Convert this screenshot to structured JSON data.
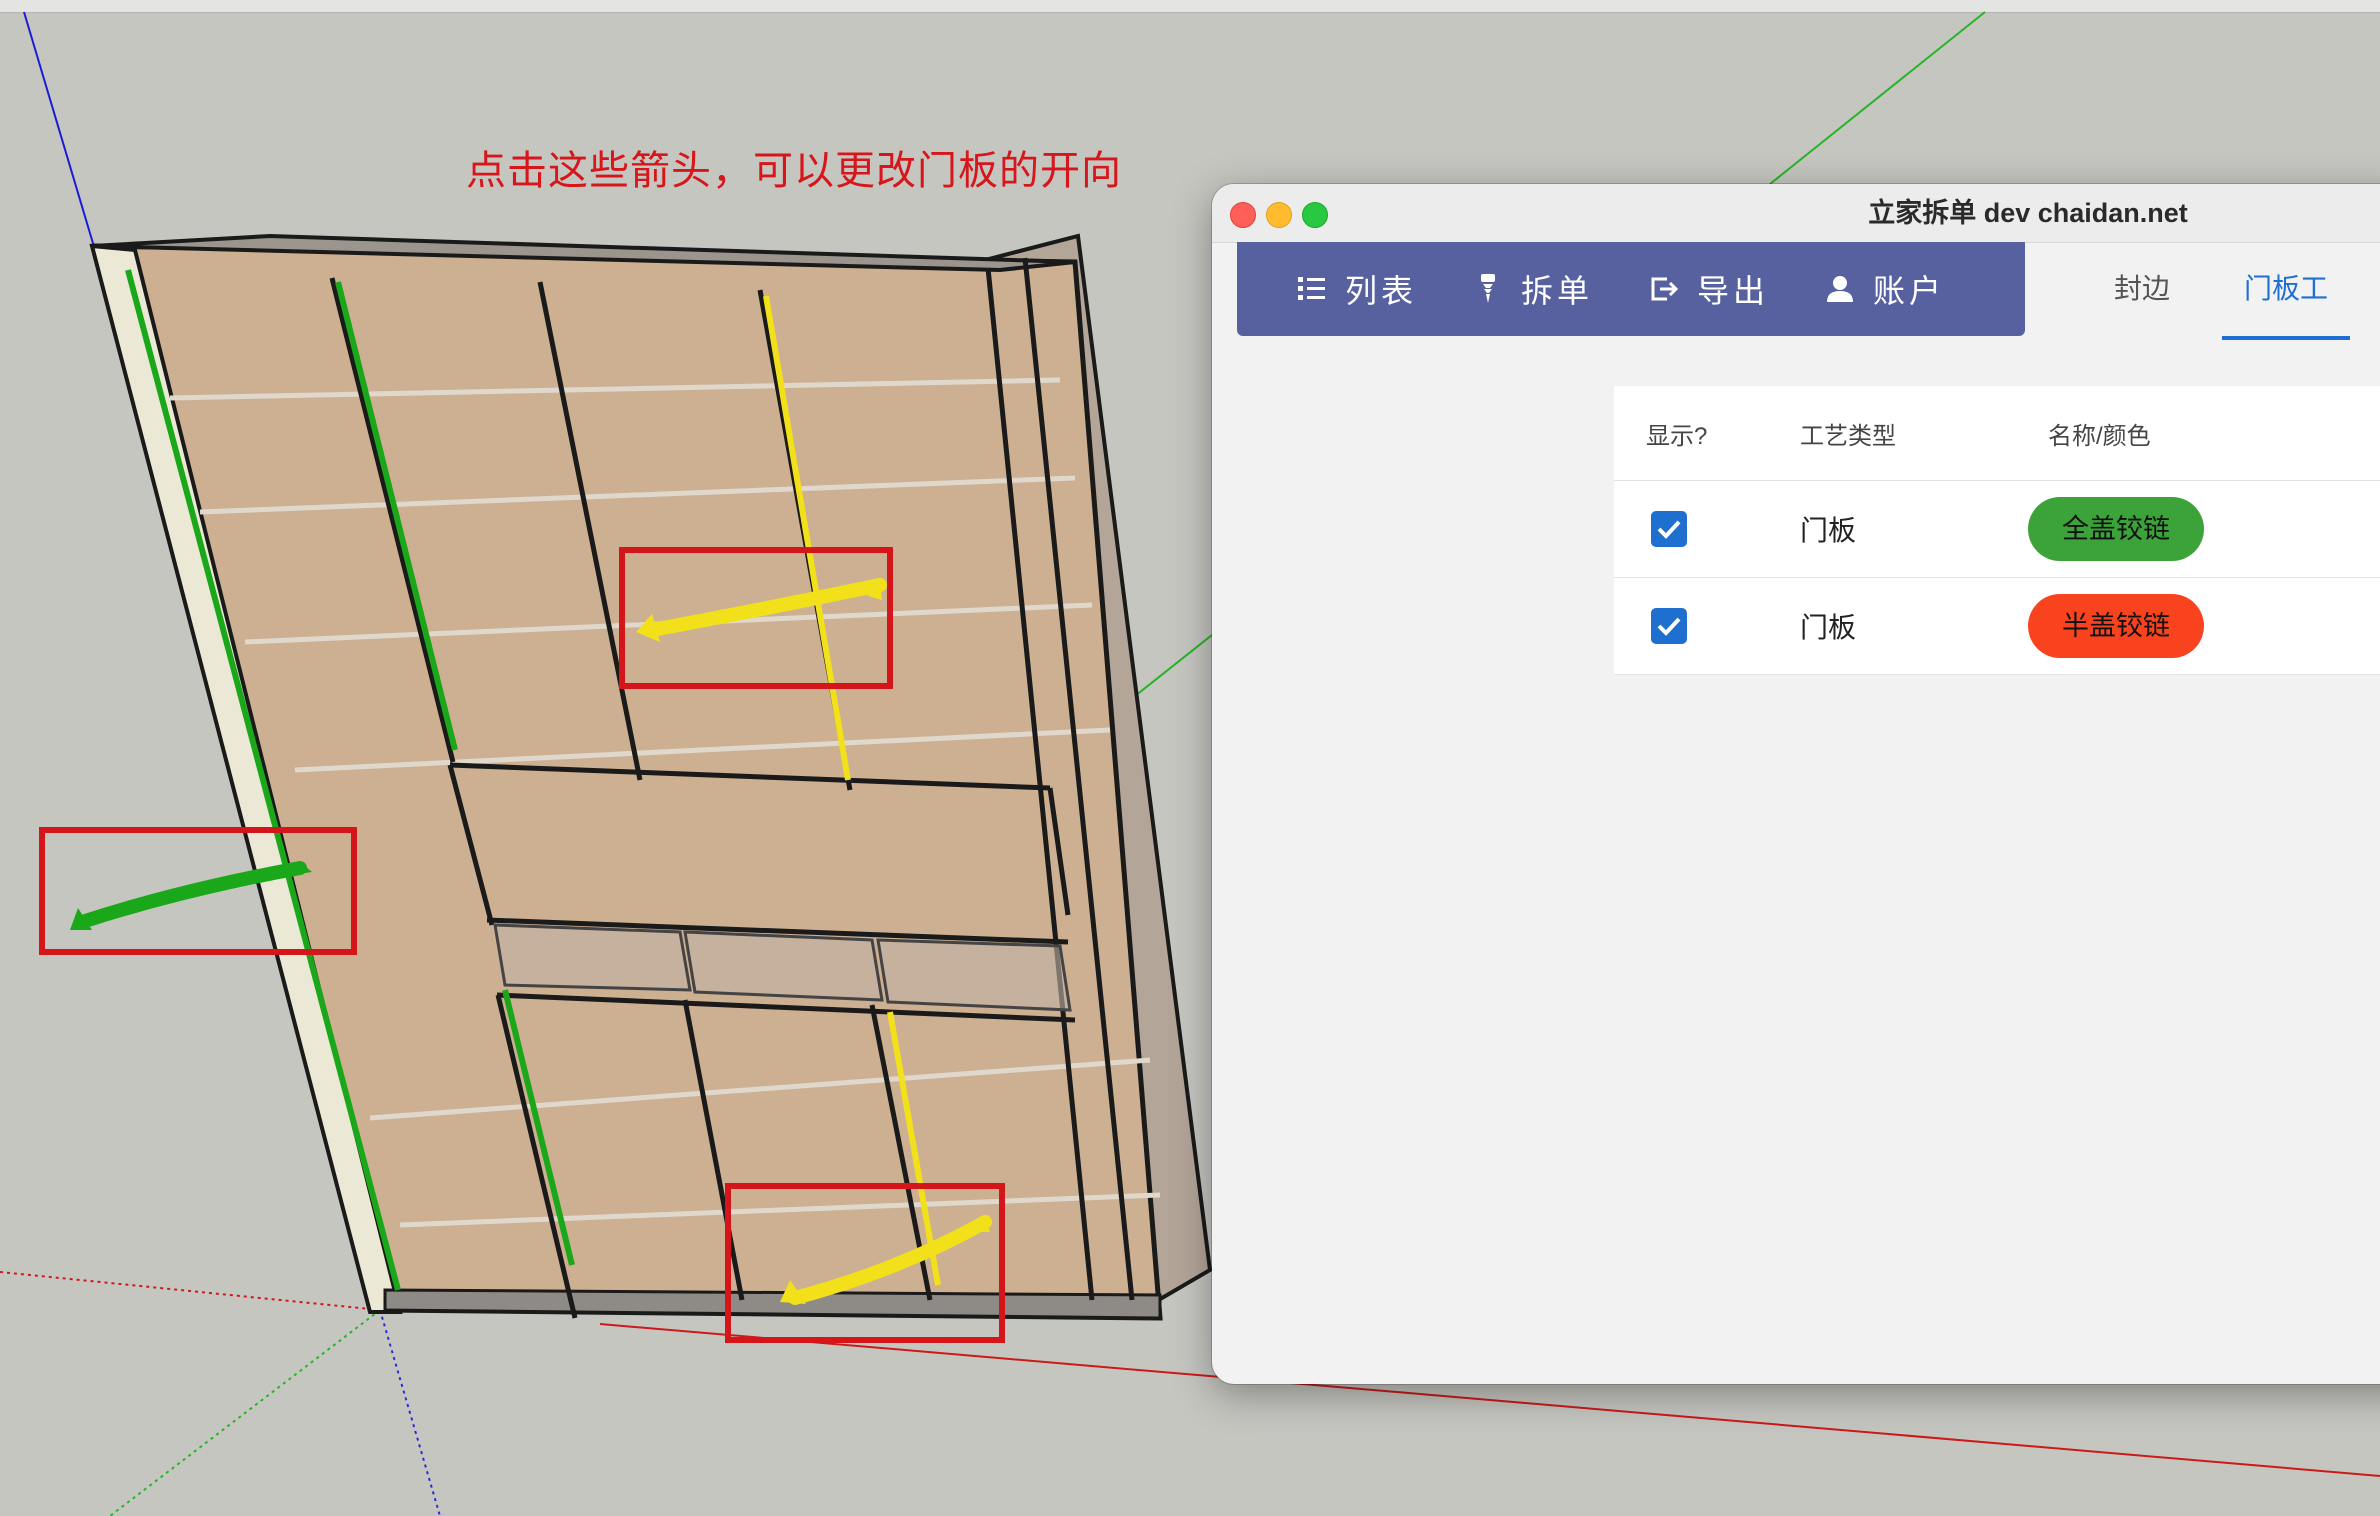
{
  "annotation": {
    "text": "点击这些箭头，可以更改门板的开向"
  },
  "window": {
    "title": "立家拆单 dev  chaidan.net"
  },
  "nav": {
    "items": [
      {
        "label": "列表",
        "icon": "list-icon"
      },
      {
        "label": "拆单",
        "icon": "drill-icon"
      },
      {
        "label": "导出",
        "icon": "export-icon"
      },
      {
        "label": "账户",
        "icon": "person-icon"
      }
    ]
  },
  "tabs": [
    {
      "label": "封边",
      "active": false
    },
    {
      "label": "门板工",
      "active": true
    }
  ],
  "table": {
    "headers": [
      "显示?",
      "工艺类型",
      "名称/颜色"
    ],
    "rows": [
      {
        "checked": true,
        "type": "门板",
        "name": "全盖铰链",
        "color": "#3ca33a"
      },
      {
        "checked": true,
        "type": "门板",
        "name": "半盖铰链",
        "color": "#f9421e"
      }
    ]
  },
  "colors": {
    "nav_bg": "#5861a0",
    "accent": "#1f6fd1",
    "annotation": "#d6161b",
    "highlight_box": "#d4161b",
    "door_full_overlay": "#3aa23a",
    "door_half_overlay": "#f2e11a"
  }
}
